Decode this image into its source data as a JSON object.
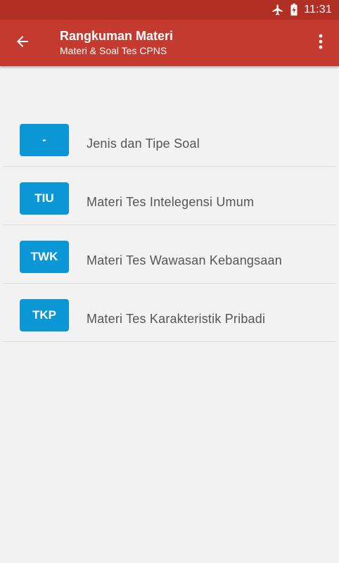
{
  "status_bar": {
    "time": "11:31",
    "icons": [
      "airplane-mode-icon",
      "battery-charging-icon"
    ]
  },
  "app_bar": {
    "title": "Rangkuman Materi",
    "subtitle": "Materi & Soal Tes CPNS",
    "back_icon": "arrow-back-icon",
    "menu_icon": "more-vert-icon"
  },
  "items": [
    {
      "badge": "-",
      "label": "Jenis dan Tipe Soal"
    },
    {
      "badge": "TIU",
      "label": "Materi Tes Intelegensi Umum"
    },
    {
      "badge": "TWK",
      "label": "Materi Tes Wawasan Kebangsaan"
    },
    {
      "badge": "TKP",
      "label": "Materi Tes Karakteristik Pribadi"
    }
  ],
  "colors": {
    "status_bar": "#b12f24",
    "app_bar": "#c43a2e",
    "badge": "#0b96d6",
    "background": "#f2f2f2"
  }
}
